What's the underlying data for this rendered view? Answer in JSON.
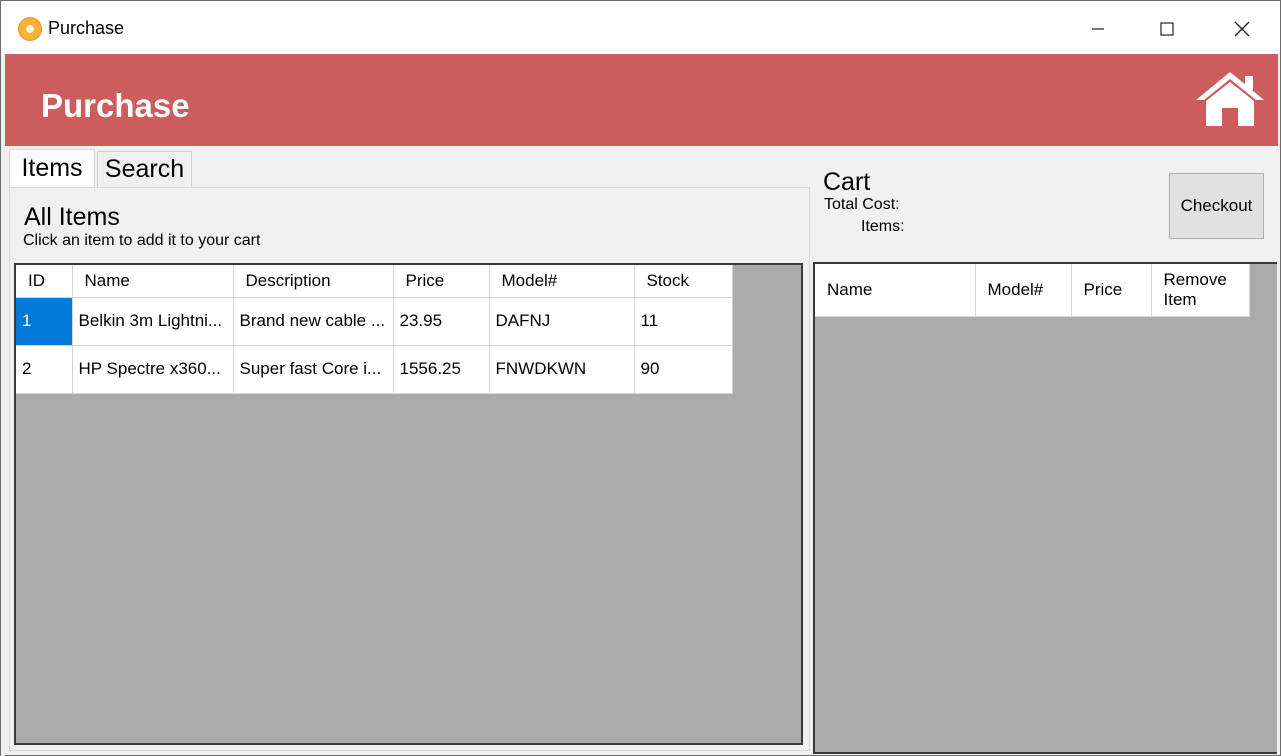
{
  "window": {
    "title": "Purchase"
  },
  "header": {
    "title": "Purchase",
    "background_color": "#cd5c5c"
  },
  "tabs": [
    {
      "label": "Items",
      "active": true
    },
    {
      "label": "Search",
      "active": false
    }
  ],
  "items_panel": {
    "title": "All Items",
    "subtitle": "Click an item to add it to your cart",
    "columns": [
      "ID",
      "Name",
      "Description",
      "Price",
      "Model#",
      "Stock"
    ],
    "rows": [
      {
        "id": "1",
        "name": "Belkin 3m Lightni...",
        "description": "Brand new cable ...",
        "price": "23.95",
        "model": "DAFNJ",
        "stock": "11"
      },
      {
        "id": "2",
        "name": "HP Spectre x360...",
        "description": "Super fast Core i...",
        "price": "1556.25",
        "model": "FNWDKWN",
        "stock": "90"
      }
    ]
  },
  "cart": {
    "title": "Cart",
    "total_cost_label": "Total Cost:",
    "items_label": "Items:",
    "checkout_label": "Checkout",
    "columns": [
      "Name",
      "Model#",
      "Price",
      "Remove Item"
    ]
  },
  "icons": {
    "app": "app-icon",
    "home": "home-icon"
  },
  "colors": {
    "accent": "#cd5c5c",
    "selection": "#0078d7",
    "grid_background": "#ababab"
  }
}
